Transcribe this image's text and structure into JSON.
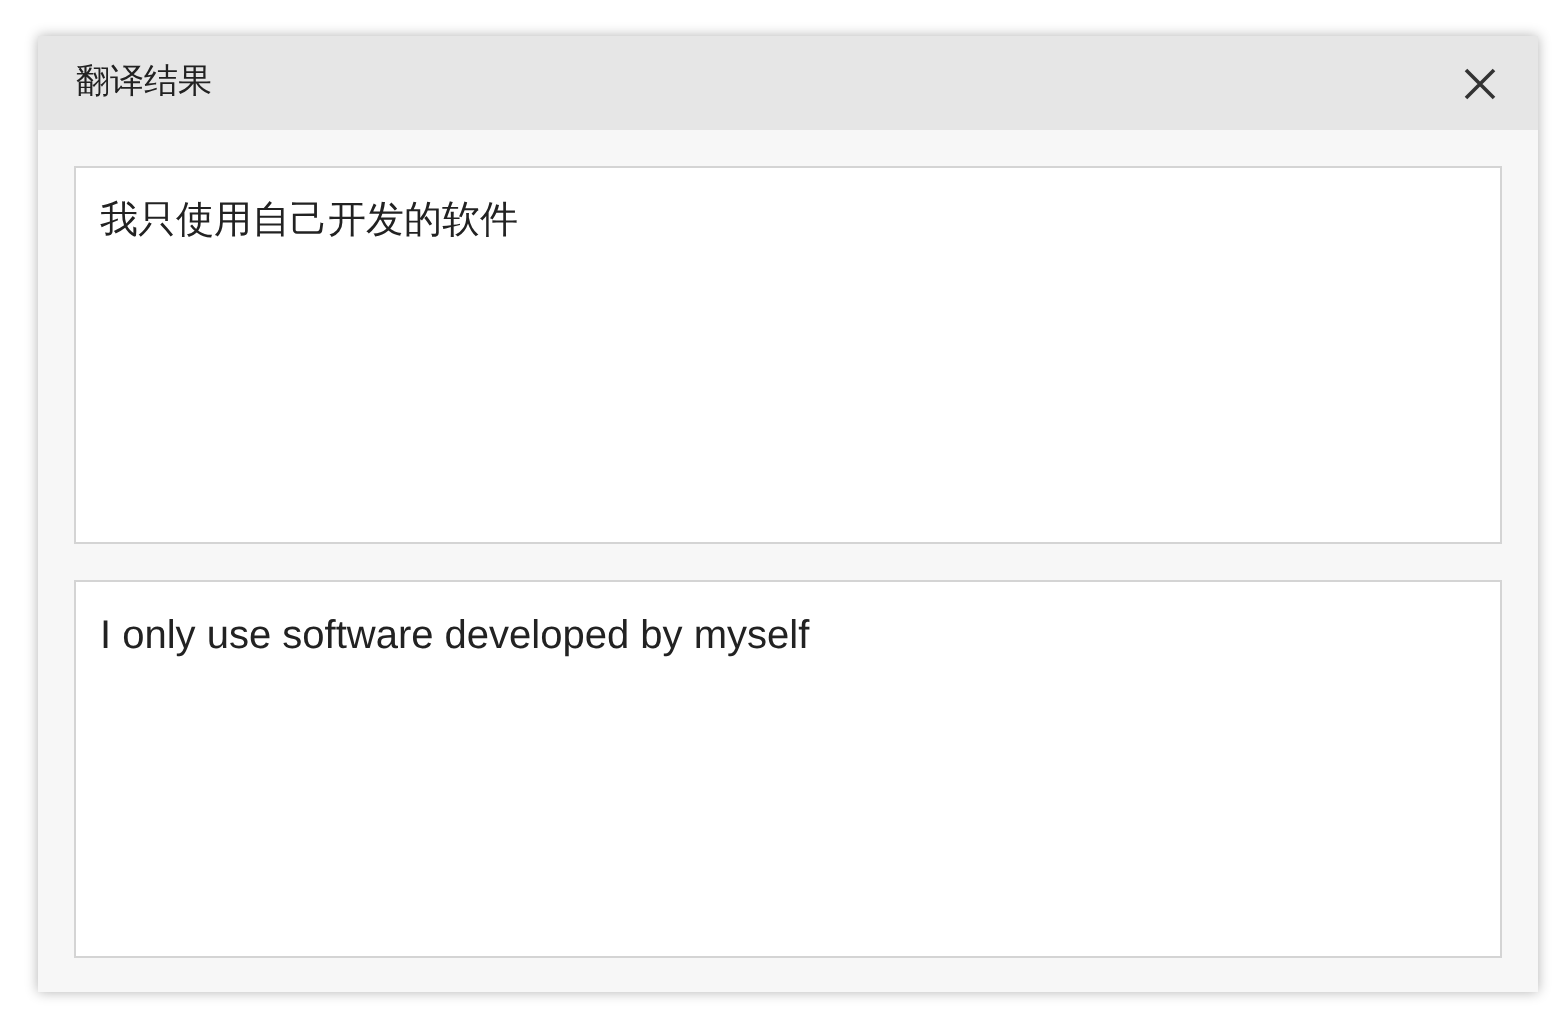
{
  "dialog": {
    "title": "翻译结果"
  },
  "source_text": "我只使用自己开发的软件",
  "translated_text": "I only use software developed by myself"
}
